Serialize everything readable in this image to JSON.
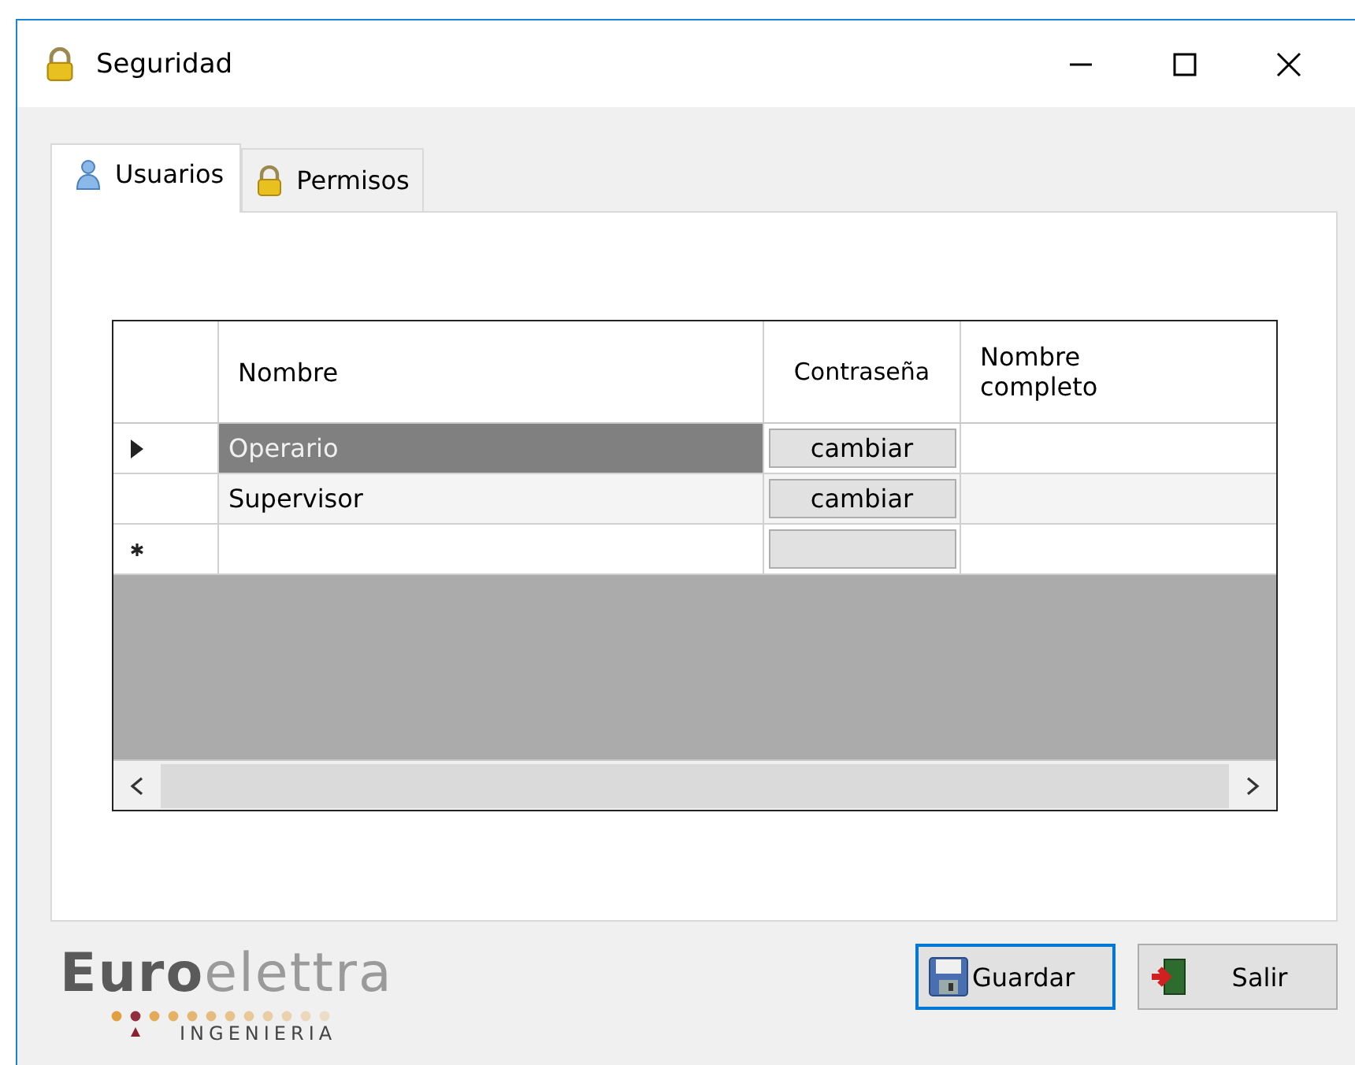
{
  "window": {
    "title": "Seguridad"
  },
  "tabs": [
    {
      "label": "Usuarios",
      "selected": true
    },
    {
      "label": "Permisos",
      "selected": false
    }
  ],
  "grid": {
    "columns": [
      "Nombre",
      "Contraseña",
      "Nombre completo"
    ],
    "rows": [
      {
        "kind": "data",
        "current": true,
        "selected": true,
        "name": "Operario",
        "password_button": "cambiar"
      },
      {
        "kind": "data",
        "current": false,
        "selected": false,
        "name": "Supervisor",
        "password_button": "cambiar"
      },
      {
        "kind": "new",
        "current": false,
        "selected": false
      }
    ]
  },
  "logo": {
    "name": "**Euro**elettra",
    "tagline": "INGENIERIA"
  },
  "buttons": [
    {
      "label": "Guardar",
      "focused": true
    },
    {
      "label": "Salir",
      "focused": false
    }
  ]
}
